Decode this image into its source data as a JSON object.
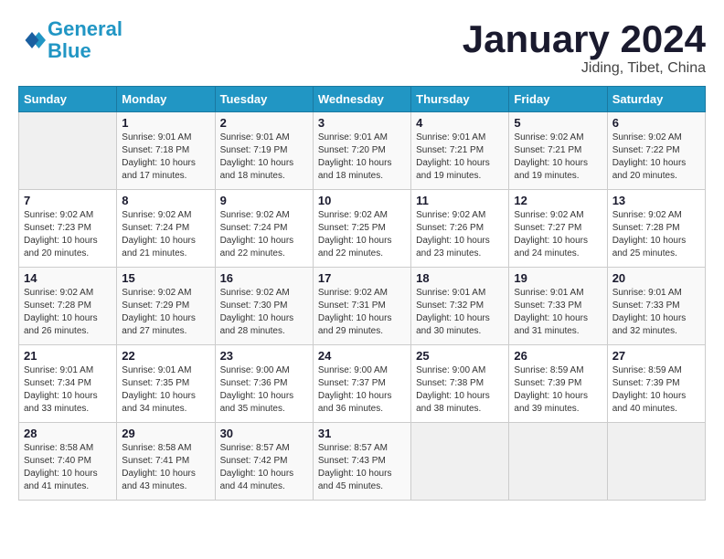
{
  "logo": {
    "line1": "General",
    "line2": "Blue"
  },
  "title": "January 2024",
  "subtitle": "Jiding, Tibet, China",
  "weekdays": [
    "Sunday",
    "Monday",
    "Tuesday",
    "Wednesday",
    "Thursday",
    "Friday",
    "Saturday"
  ],
  "weeks": [
    [
      {
        "day": "",
        "sunrise": "",
        "sunset": "",
        "daylight": ""
      },
      {
        "day": "1",
        "sunrise": "Sunrise: 9:01 AM",
        "sunset": "Sunset: 7:18 PM",
        "daylight": "Daylight: 10 hours and 17 minutes."
      },
      {
        "day": "2",
        "sunrise": "Sunrise: 9:01 AM",
        "sunset": "Sunset: 7:19 PM",
        "daylight": "Daylight: 10 hours and 18 minutes."
      },
      {
        "day": "3",
        "sunrise": "Sunrise: 9:01 AM",
        "sunset": "Sunset: 7:20 PM",
        "daylight": "Daylight: 10 hours and 18 minutes."
      },
      {
        "day": "4",
        "sunrise": "Sunrise: 9:01 AM",
        "sunset": "Sunset: 7:21 PM",
        "daylight": "Daylight: 10 hours and 19 minutes."
      },
      {
        "day": "5",
        "sunrise": "Sunrise: 9:02 AM",
        "sunset": "Sunset: 7:21 PM",
        "daylight": "Daylight: 10 hours and 19 minutes."
      },
      {
        "day": "6",
        "sunrise": "Sunrise: 9:02 AM",
        "sunset": "Sunset: 7:22 PM",
        "daylight": "Daylight: 10 hours and 20 minutes."
      }
    ],
    [
      {
        "day": "7",
        "sunrise": "Sunrise: 9:02 AM",
        "sunset": "Sunset: 7:23 PM",
        "daylight": "Daylight: 10 hours and 20 minutes."
      },
      {
        "day": "8",
        "sunrise": "Sunrise: 9:02 AM",
        "sunset": "Sunset: 7:24 PM",
        "daylight": "Daylight: 10 hours and 21 minutes."
      },
      {
        "day": "9",
        "sunrise": "Sunrise: 9:02 AM",
        "sunset": "Sunset: 7:24 PM",
        "daylight": "Daylight: 10 hours and 22 minutes."
      },
      {
        "day": "10",
        "sunrise": "Sunrise: 9:02 AM",
        "sunset": "Sunset: 7:25 PM",
        "daylight": "Daylight: 10 hours and 22 minutes."
      },
      {
        "day": "11",
        "sunrise": "Sunrise: 9:02 AM",
        "sunset": "Sunset: 7:26 PM",
        "daylight": "Daylight: 10 hours and 23 minutes."
      },
      {
        "day": "12",
        "sunrise": "Sunrise: 9:02 AM",
        "sunset": "Sunset: 7:27 PM",
        "daylight": "Daylight: 10 hours and 24 minutes."
      },
      {
        "day": "13",
        "sunrise": "Sunrise: 9:02 AM",
        "sunset": "Sunset: 7:28 PM",
        "daylight": "Daylight: 10 hours and 25 minutes."
      }
    ],
    [
      {
        "day": "14",
        "sunrise": "Sunrise: 9:02 AM",
        "sunset": "Sunset: 7:28 PM",
        "daylight": "Daylight: 10 hours and 26 minutes."
      },
      {
        "day": "15",
        "sunrise": "Sunrise: 9:02 AM",
        "sunset": "Sunset: 7:29 PM",
        "daylight": "Daylight: 10 hours and 27 minutes."
      },
      {
        "day": "16",
        "sunrise": "Sunrise: 9:02 AM",
        "sunset": "Sunset: 7:30 PM",
        "daylight": "Daylight: 10 hours and 28 minutes."
      },
      {
        "day": "17",
        "sunrise": "Sunrise: 9:02 AM",
        "sunset": "Sunset: 7:31 PM",
        "daylight": "Daylight: 10 hours and 29 minutes."
      },
      {
        "day": "18",
        "sunrise": "Sunrise: 9:01 AM",
        "sunset": "Sunset: 7:32 PM",
        "daylight": "Daylight: 10 hours and 30 minutes."
      },
      {
        "day": "19",
        "sunrise": "Sunrise: 9:01 AM",
        "sunset": "Sunset: 7:33 PM",
        "daylight": "Daylight: 10 hours and 31 minutes."
      },
      {
        "day": "20",
        "sunrise": "Sunrise: 9:01 AM",
        "sunset": "Sunset: 7:33 PM",
        "daylight": "Daylight: 10 hours and 32 minutes."
      }
    ],
    [
      {
        "day": "21",
        "sunrise": "Sunrise: 9:01 AM",
        "sunset": "Sunset: 7:34 PM",
        "daylight": "Daylight: 10 hours and 33 minutes."
      },
      {
        "day": "22",
        "sunrise": "Sunrise: 9:01 AM",
        "sunset": "Sunset: 7:35 PM",
        "daylight": "Daylight: 10 hours and 34 minutes."
      },
      {
        "day": "23",
        "sunrise": "Sunrise: 9:00 AM",
        "sunset": "Sunset: 7:36 PM",
        "daylight": "Daylight: 10 hours and 35 minutes."
      },
      {
        "day": "24",
        "sunrise": "Sunrise: 9:00 AM",
        "sunset": "Sunset: 7:37 PM",
        "daylight": "Daylight: 10 hours and 36 minutes."
      },
      {
        "day": "25",
        "sunrise": "Sunrise: 9:00 AM",
        "sunset": "Sunset: 7:38 PM",
        "daylight": "Daylight: 10 hours and 38 minutes."
      },
      {
        "day": "26",
        "sunrise": "Sunrise: 8:59 AM",
        "sunset": "Sunset: 7:39 PM",
        "daylight": "Daylight: 10 hours and 39 minutes."
      },
      {
        "day": "27",
        "sunrise": "Sunrise: 8:59 AM",
        "sunset": "Sunset: 7:39 PM",
        "daylight": "Daylight: 10 hours and 40 minutes."
      }
    ],
    [
      {
        "day": "28",
        "sunrise": "Sunrise: 8:58 AM",
        "sunset": "Sunset: 7:40 PM",
        "daylight": "Daylight: 10 hours and 41 minutes."
      },
      {
        "day": "29",
        "sunrise": "Sunrise: 8:58 AM",
        "sunset": "Sunset: 7:41 PM",
        "daylight": "Daylight: 10 hours and 43 minutes."
      },
      {
        "day": "30",
        "sunrise": "Sunrise: 8:57 AM",
        "sunset": "Sunset: 7:42 PM",
        "daylight": "Daylight: 10 hours and 44 minutes."
      },
      {
        "day": "31",
        "sunrise": "Sunrise: 8:57 AM",
        "sunset": "Sunset: 7:43 PM",
        "daylight": "Daylight: 10 hours and 45 minutes."
      },
      {
        "day": "",
        "sunrise": "",
        "sunset": "",
        "daylight": ""
      },
      {
        "day": "",
        "sunrise": "",
        "sunset": "",
        "daylight": ""
      },
      {
        "day": "",
        "sunrise": "",
        "sunset": "",
        "daylight": ""
      }
    ]
  ]
}
